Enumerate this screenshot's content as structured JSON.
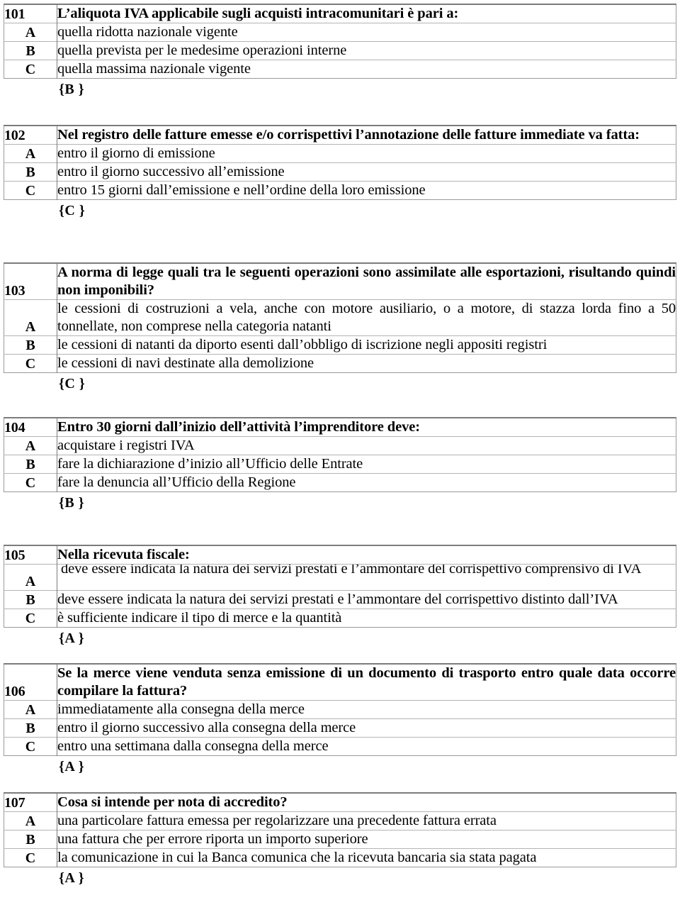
{
  "document": {
    "language": "it",
    "answer_marker_open": "{",
    "answer_marker_close": " }"
  },
  "questions": [
    {
      "number": "101",
      "prompt": "L’aliquota IVA applicabile sugli acquisti intracomunitari è pari a:",
      "options": [
        {
          "letter": "A",
          "text": "quella ridotta nazionale vigente"
        },
        {
          "letter": "B",
          "text": "quella prevista per le medesime operazioni interne"
        },
        {
          "letter": "C",
          "text": "quella massima nazionale vigente"
        }
      ],
      "answer": "{B }"
    },
    {
      "number": "102",
      "prompt": "Nel registro delle fatture emesse e/o corrispettivi l’annotazione delle fatture immediate va fatta:",
      "options": [
        {
          "letter": "A",
          "text": "entro il giorno di emissione"
        },
        {
          "letter": "B",
          "text": "entro il giorno successivo all’emissione"
        },
        {
          "letter": "C",
          "text": "entro 15 giorni dall’emissione e nell’ordine della loro emissione"
        }
      ],
      "answer": "{C }"
    },
    {
      "number": "103",
      "prompt": "A norma di legge quali tra le seguenti operazioni sono assimilate alle esportazioni, risultando quindi non imponibili?",
      "options": [
        {
          "letter": "A",
          "text": "le cessioni di costruzioni a vela, anche con motore ausiliario, o a motore, di stazza lorda fino a 50 tonnellate, non comprese nella categoria natanti"
        },
        {
          "letter": "B",
          "text": "le cessioni di natanti da diporto esenti dall’obbligo di iscrizione negli appositi registri"
        },
        {
          "letter": "C",
          "text": "le cessioni di navi destinate alla demolizione"
        }
      ],
      "answer": "{C }"
    },
    {
      "number": "104",
      "prompt": "Entro 30 giorni dall’inizio dell’attività l’imprenditore deve:",
      "options": [
        {
          "letter": "A",
          "text": "acquistare i registri IVA"
        },
        {
          "letter": "B",
          "text": "fare la dichiarazione d’inizio all’Ufficio delle Entrate"
        },
        {
          "letter": "C",
          "text": "fare la denuncia all’Ufficio della Regione"
        }
      ],
      "answer": "{B }"
    },
    {
      "number": "105",
      "prompt": "Nella ricevuta fiscale:",
      "options": [
        {
          "letter": "A",
          "text": "deve essere indicata la natura dei servizi prestati e l’ammontare del corrispettivo comprensivo di IVA"
        },
        {
          "letter": "B",
          "text": "deve essere indicata la natura dei servizi prestati e l’ammontare del corrispettivo distinto dall’IVA"
        },
        {
          "letter": "C",
          "text": "è sufficiente indicare il tipo di merce e la quantità"
        }
      ],
      "answer": "{A }"
    },
    {
      "number": "106",
      "prompt": "Se la merce viene venduta senza emissione di un documento di trasporto entro quale data occorre compilare la fattura?",
      "options": [
        {
          "letter": "A",
          "text": "immediatamente alla consegna della merce"
        },
        {
          "letter": "B",
          "text": "entro il giorno successivo alla consegna della merce"
        },
        {
          "letter": "C",
          "text": "entro una settimana dalla consegna della merce"
        }
      ],
      "answer": "{A }"
    },
    {
      "number": "107",
      "prompt": "Cosa si intende per nota di accredito?",
      "options": [
        {
          "letter": "A",
          "text": "una particolare fattura emessa per regolarizzare una precedente fattura errata"
        },
        {
          "letter": "B",
          "text": "una fattura che per errore riporta un importo superiore"
        },
        {
          "letter": "C",
          "text": "la comunicazione in cui la Banca comunica che la ricevuta bancaria sia stata pagata"
        }
      ],
      "answer": "{A }"
    }
  ]
}
